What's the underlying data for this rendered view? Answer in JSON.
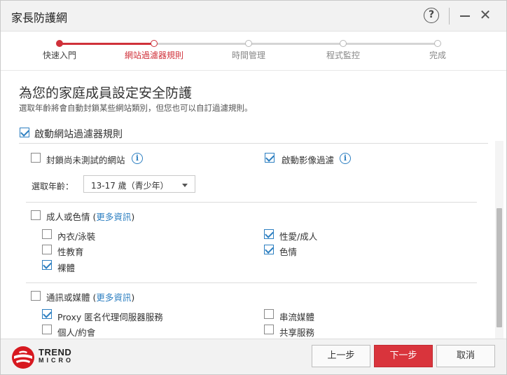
{
  "window": {
    "title": "家長防護網"
  },
  "titlebar": {
    "help_icon": "?",
    "close_icon": "✕"
  },
  "steps": [
    {
      "label": "快速入門",
      "state": "done"
    },
    {
      "label": "網站過濾器規則",
      "state": "current"
    },
    {
      "label": "時間管理",
      "state": "pending"
    },
    {
      "label": "程式監控",
      "state": "pending"
    },
    {
      "label": "完成",
      "state": "pending"
    }
  ],
  "main": {
    "heading": "為您的家庭成員設定安全防護",
    "subheading": "選取年齡將會自動封鎖某些網站類別，但您也可以自訂過濾規則。",
    "enable_filter": {
      "label": "啟動網站過濾器規則",
      "checked": true
    }
  },
  "options": {
    "block_untested": {
      "label": "封鎖尚未測試的網站",
      "checked": false
    },
    "image_filter": {
      "label": "啟動影像過濾",
      "checked": true
    },
    "age_label": "選取年齡：",
    "age_value": "13-17 歲（青少年）"
  },
  "categories": [
    {
      "name": "成人或色情",
      "more_link": "更多資訊",
      "checked": false,
      "items": [
        {
          "label": "內衣/泳裝",
          "checked": false
        },
        {
          "label": "性愛/成人",
          "checked": true
        },
        {
          "label": "性教育",
          "checked": false
        },
        {
          "label": "色情",
          "checked": true
        },
        {
          "label": "裸體",
          "checked": true
        }
      ]
    },
    {
      "name": "通訊或媒體",
      "more_link": "更多資訊",
      "checked": false,
      "items": [
        {
          "label": "Proxy 匿名代理伺服器服務",
          "checked": true
        },
        {
          "label": "串流媒體",
          "checked": false
        },
        {
          "label": "個人/約會",
          "checked": false
        },
        {
          "label": "共享服務",
          "checked": false
        }
      ]
    }
  ],
  "footer": {
    "brand_line1": "TREND",
    "brand_line2": "MICRO",
    "back_label": "上一步",
    "next_label": "下一步",
    "cancel_label": "取消"
  },
  "colors": {
    "accent_red": "#d0313a",
    "check_blue": "#2d7fc1"
  }
}
